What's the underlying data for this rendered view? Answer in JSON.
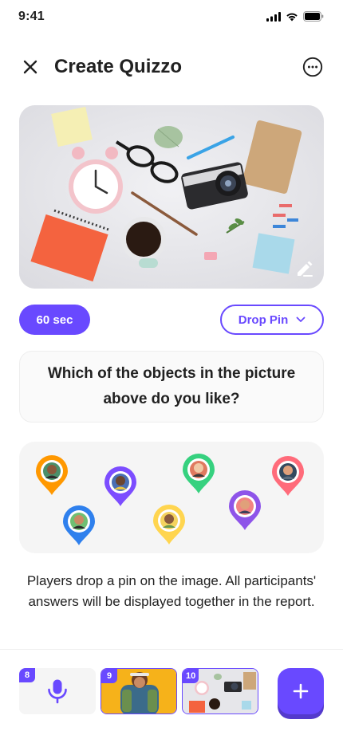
{
  "status_bar": {
    "time": "9:41"
  },
  "header": {
    "title": "Create Quizzo"
  },
  "controls": {
    "time_limit": "60 sec",
    "question_type": "Drop Pin"
  },
  "question": {
    "text": "Which of the objects in the picture above do you like?"
  },
  "description": "Players drop a pin on the image. All participants' answers will be displayed together in the report.",
  "pins": [
    {
      "color": "#ff9800"
    },
    {
      "color": "#7c4dff"
    },
    {
      "color": "#36d17f"
    },
    {
      "color": "#ff6b7a"
    },
    {
      "color": "#2f80ed"
    },
    {
      "color": "#ffd54f"
    },
    {
      "color": "#8e54e9"
    }
  ],
  "slides": [
    {
      "number": "8",
      "kind": "mic-icon"
    },
    {
      "number": "9",
      "kind": "photo"
    },
    {
      "number": "10",
      "kind": "photo"
    }
  ],
  "colors": {
    "primary": "#6949ff",
    "text": "#212121"
  }
}
